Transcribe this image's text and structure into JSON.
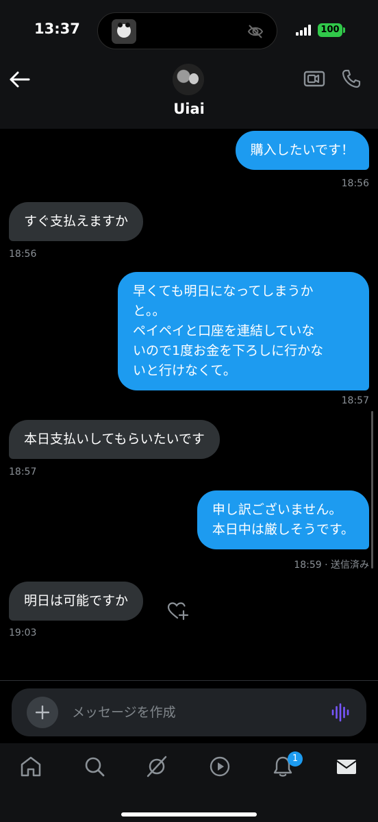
{
  "status_bar": {
    "time": "13:37",
    "battery": "100"
  },
  "header": {
    "contact_name": "Uiai",
    "icons": [
      "back-arrow-icon",
      "video-call-icon",
      "phone-icon"
    ]
  },
  "messages": [
    {
      "direction": "out",
      "text": "購入したいです！",
      "time": "18:56"
    },
    {
      "direction": "in",
      "text": "すぐ支払えますか",
      "time": "18:56"
    },
    {
      "direction": "out",
      "text": "早くても明日になってしまうか\nと。。\nペイペイと口座を連結していな\nいので1度お金を下ろしに行かな\nいと行けなくて。",
      "time": "18:57"
    },
    {
      "direction": "in",
      "text": "本日支払いしてもらいたいです",
      "time": "18:57"
    },
    {
      "direction": "out",
      "text": "申し訳ございません。\n本日中は厳しそうです。",
      "time": "18:59 · 送信済み"
    },
    {
      "direction": "in",
      "text": "明日は可能ですか",
      "time": "19:03"
    }
  ],
  "composer": {
    "placeholder": "メッセージを作成"
  },
  "bottom_nav": {
    "items": [
      "home-icon",
      "search-icon",
      "grok-icon",
      "video-icon",
      "notifications-icon",
      "messages-icon"
    ],
    "notification_badge": "1"
  },
  "colors": {
    "accent": "#1d9bf0",
    "incoming_bubble": "#2f3336",
    "background": "#000000",
    "voice_accent": "#7856ff"
  }
}
